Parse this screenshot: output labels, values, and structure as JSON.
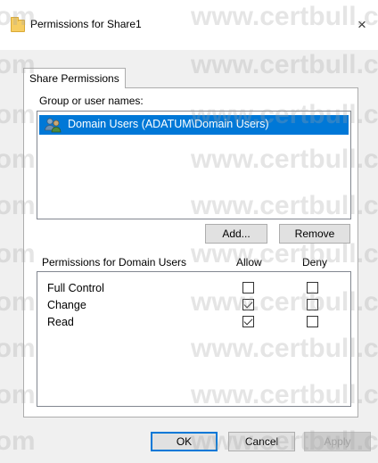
{
  "window": {
    "title": "Permissions for Share1",
    "close_glyph": "×"
  },
  "tabs": [
    {
      "label": "Share Permissions"
    }
  ],
  "group": {
    "label": "Group or user names:",
    "items": [
      {
        "label": "Domain Users (ADATUM\\Domain Users)",
        "icon": "users-group-icon",
        "selected": true
      }
    ]
  },
  "buttons": {
    "add": "Add...",
    "remove": "Remove",
    "ok": "OK",
    "cancel": "Cancel",
    "apply": "Apply"
  },
  "permissions": {
    "header": "Permissions for Domain Users",
    "allow_label": "Allow",
    "deny_label": "Deny",
    "rows": [
      {
        "name": "Full Control",
        "allow": false,
        "deny": false
      },
      {
        "name": "Change",
        "allow": true,
        "deny": false
      },
      {
        "name": "Read",
        "allow": true,
        "deny": false
      }
    ]
  },
  "watermark": "www.certbull.com",
  "colors": {
    "selection": "#0078d7",
    "dialog_bg": "#f0f0f0",
    "button_bg": "#e1e1e1"
  }
}
